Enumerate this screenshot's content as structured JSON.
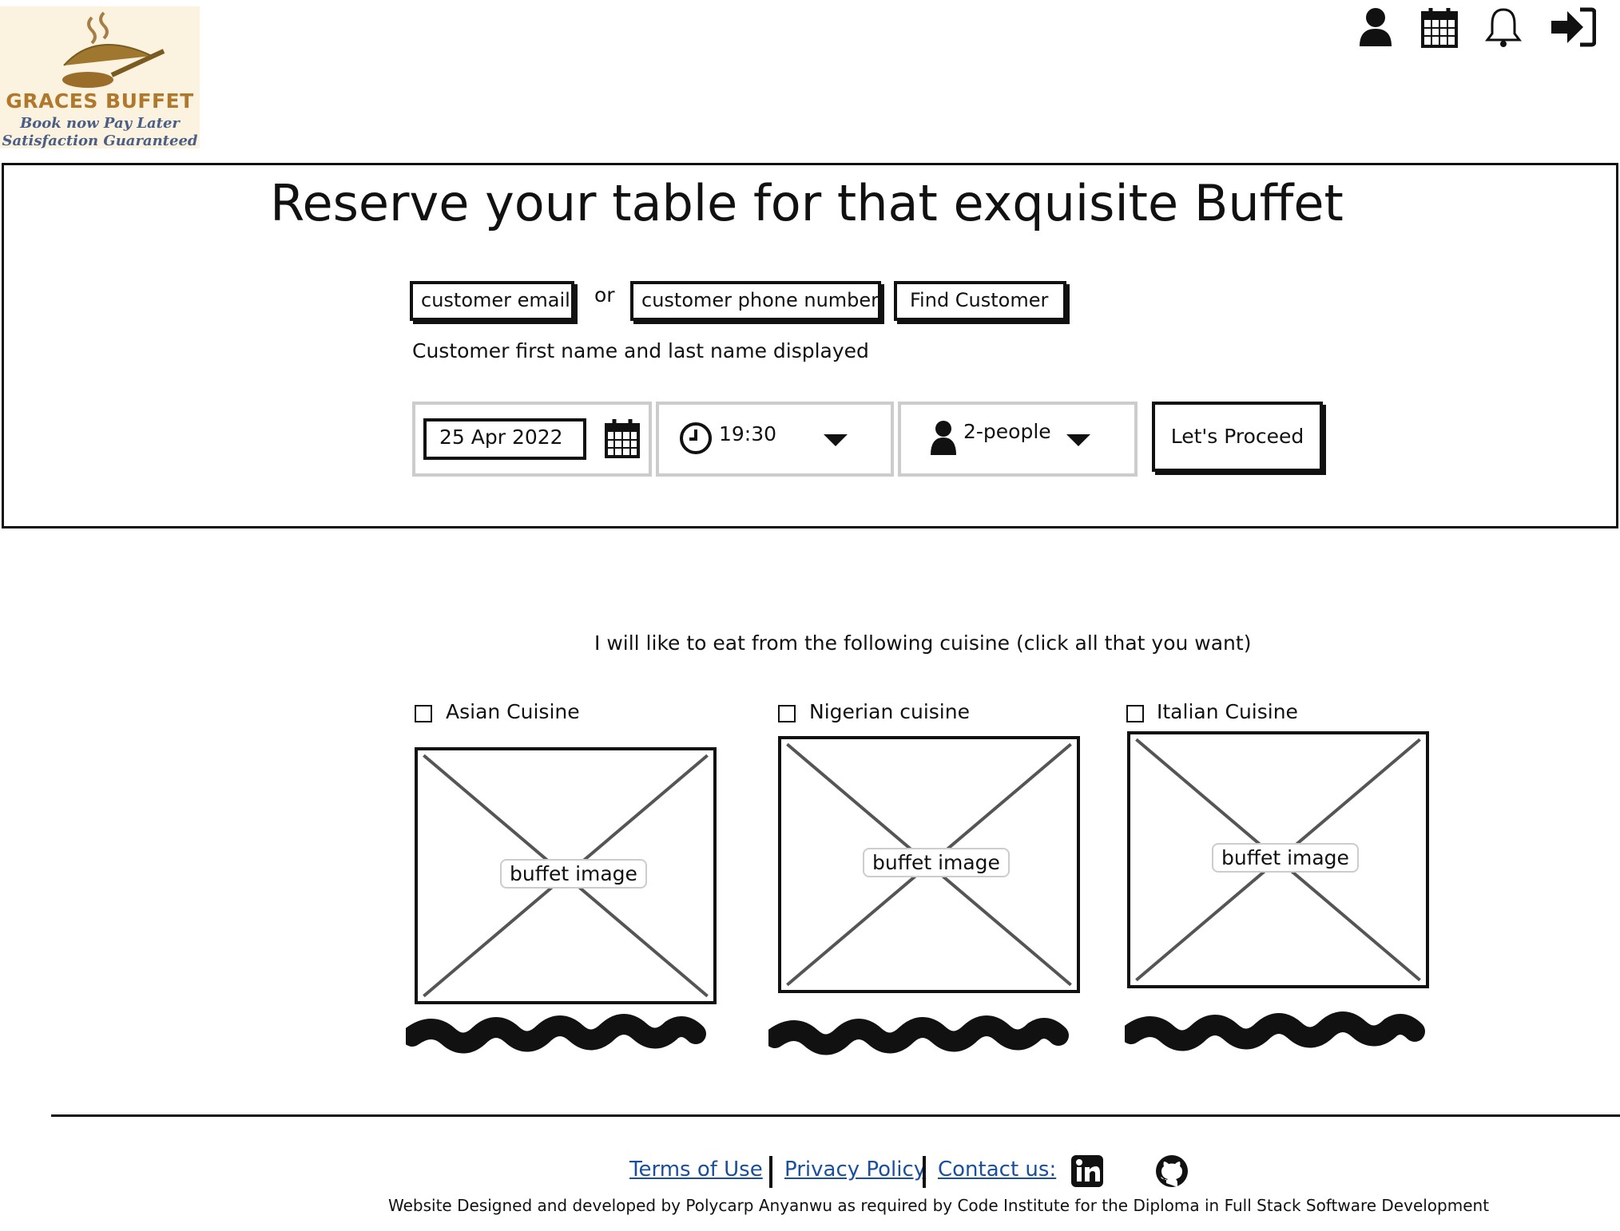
{
  "logo": {
    "line1": "GRACES BUFFET",
    "line2": "Book now Pay Later",
    "line3": "Satisfaction Guaranteed",
    "colors": {
      "brand": "#b0782c",
      "tagline": "#4a5e86"
    }
  },
  "topbar": {
    "icons": [
      "user-icon",
      "calendar-icon",
      "bell-icon",
      "sign-in-icon"
    ]
  },
  "reservation": {
    "title": "Reserve your table for that exquisite Buffet",
    "email_placeholder": "customer email",
    "or_label": "or",
    "phone_placeholder": "customer phone number",
    "find_button": "Find Customer",
    "customer_name_text": "Customer first name and last name displayed",
    "date_value": "25 Apr 2022",
    "time_value": "19:30",
    "people_value": "2-people",
    "proceed_button": "Let's Proceed"
  },
  "cuisine": {
    "prompt": "I will like to eat from the following cuisine (click all that you want)",
    "options": [
      {
        "label": "Asian Cuisine",
        "image_label": "buffet image",
        "checked": false
      },
      {
        "label": "Nigerian cuisine",
        "image_label": "buffet image",
        "checked": false
      },
      {
        "label": "Italian Cuisine",
        "image_label": "buffet image",
        "checked": false
      }
    ]
  },
  "footer": {
    "links": [
      "Terms of Use",
      "Privacy Policy",
      "Contact us:"
    ],
    "social_icons": [
      "linkedin-icon",
      "github-icon"
    ],
    "credit": "Website Designed and developed by Polycarp Anyanwu as required by Code Institute for the  Diploma in Full Stack Software Development",
    "link_color": "#1a4fa0"
  }
}
